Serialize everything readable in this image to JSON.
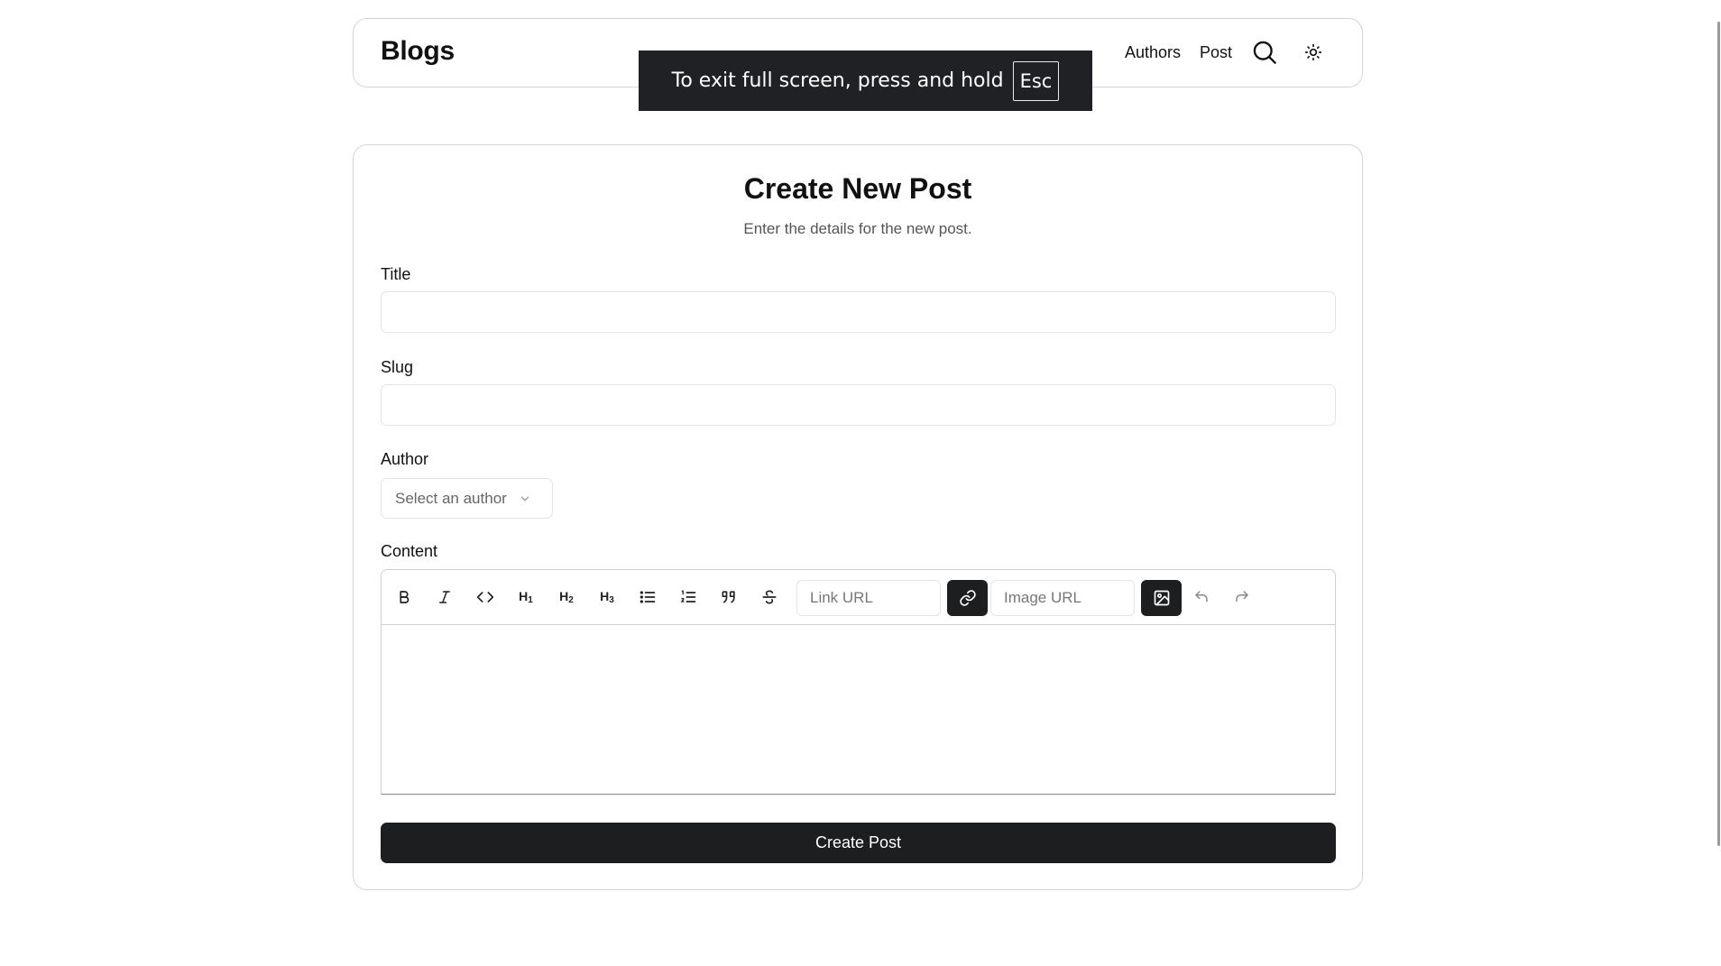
{
  "header": {
    "brand": "Blogs",
    "nav": [
      "Authors",
      "Post"
    ]
  },
  "toast": {
    "message": "To exit full screen, press and hold",
    "key": "Esc"
  },
  "form": {
    "title": "Create New Post",
    "subtitle": "Enter the details for the new post.",
    "title_label": "Title",
    "title_value": "",
    "slug_label": "Slug",
    "slug_value": "",
    "author_label": "Author",
    "author_placeholder": "Select an author",
    "content_label": "Content",
    "link_placeholder": "Link URL",
    "image_placeholder": "Image URL",
    "submit_label": "Create Post"
  },
  "toolbar_icons": [
    "bold-icon",
    "italic-icon",
    "code-icon",
    "heading-1-icon",
    "heading-2-icon",
    "heading-3-icon",
    "bullet-list-icon",
    "ordered-list-icon",
    "quote-icon",
    "strikethrough-icon",
    "link-icon",
    "image-icon",
    "undo-icon",
    "redo-icon"
  ],
  "toolbar_headings": {
    "h1": "H",
    "h1_sub": "1",
    "h2": "H",
    "h2_sub": "2",
    "h3": "H",
    "h3_sub": "3"
  },
  "colors": {
    "dark_button": "#1d1e20",
    "border": "#d4d4d8",
    "toast_bg": "#202124"
  }
}
